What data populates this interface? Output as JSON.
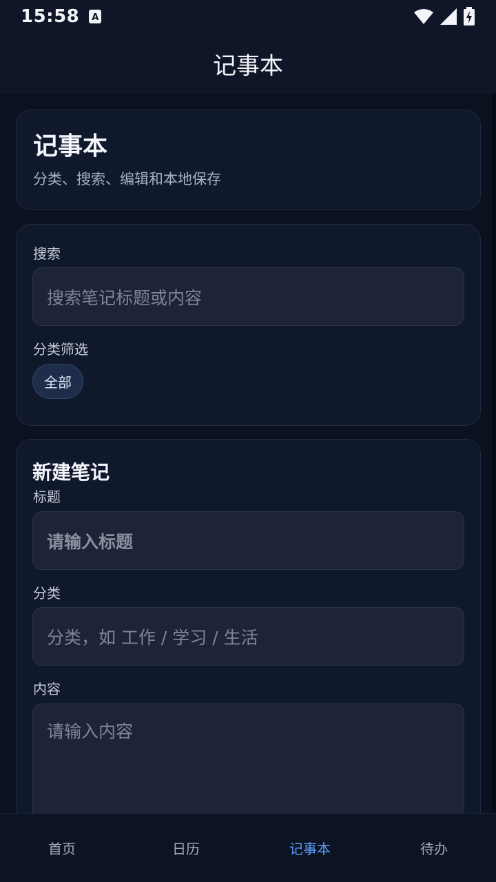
{
  "status_bar": {
    "time": "15:58",
    "notif_letter": "A"
  },
  "app_bar": {
    "title": "记事本"
  },
  "header_card": {
    "title": "记事本",
    "subtitle": "分类、搜索、编辑和本地保存"
  },
  "filter_card": {
    "search_label": "搜索",
    "search_placeholder": "搜索笔记标题或内容",
    "category_filter_label": "分类筛选",
    "chips": [
      "全部"
    ]
  },
  "new_note": {
    "section_title": "新建笔记",
    "title_label": "标题",
    "title_placeholder": "请输入标题",
    "category_label": "分类",
    "category_placeholder": "分类，如 工作 / 学习 / 生活",
    "content_label": "内容",
    "content_placeholder": "请输入内容"
  },
  "bottom_nav": {
    "items": [
      "首页",
      "日历",
      "记事本",
      "待办"
    ],
    "active": "记事本"
  },
  "colors": {
    "accent": "#5b9cf4",
    "background": "#0b111e",
    "card": "#10182b"
  }
}
